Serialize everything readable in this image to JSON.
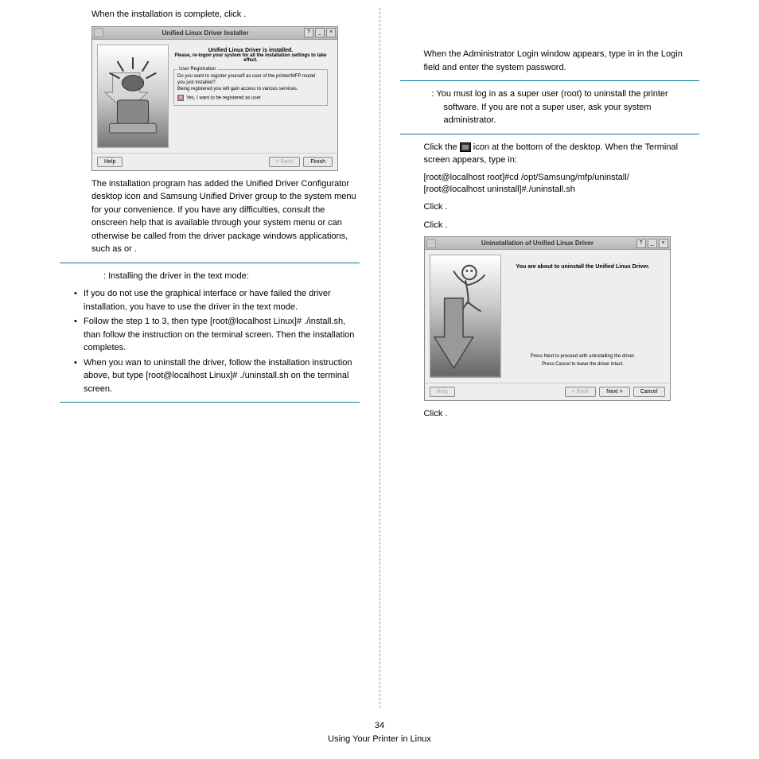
{
  "left": {
    "line1_a": "When the installation is complete, click ",
    "line1_b": ".",
    "dialog1": {
      "title": "Unified Linux Driver Installer",
      "btns": [
        "?",
        "_",
        "×"
      ],
      "heading": "Unified Linux Driver is installed.",
      "sub": "Please, re-logon your system for all the installation settings to take effect.",
      "fs_title": "User Registration",
      "fs_line1": "Do you want to register yourself as user of the printer/MFP model you just installed?",
      "fs_line2": "Being registered you will gain access to various services.",
      "fs_check": "Yes, I want to be registered as user",
      "help": "Help",
      "back": "< Back",
      "finish": "Finish"
    },
    "para2": "The installation program has added the Unified Driver Configurator desktop icon and Samsung Unified Driver group to the system menu for your convenience. If you have any difficulties, consult the onscreen help that is available through your system menu or can otherwise be called from the driver package windows applications, such as ",
    "para2_mid": " or ",
    "para2_end": ".",
    "note_label": ": Installing the driver in the text mode:",
    "bullets": [
      "If you do not use the graphical interface or have failed the driver installation, you have to use the driver in the text mode.",
      "Follow the step 1 to 3, then type [root@localhost Linux]# ./install.sh, than follow the instruction on the terminal screen. Then the installation completes.",
      "When you wan to uninstall the driver, follow the installation instruction above, but type [root@localhost Linux]# ./uninstall.sh on the terminal screen."
    ]
  },
  "right": {
    "step2a": "When the Administrator Login window appears, type in ",
    "step2b": " in the Login field and enter the system password.",
    "note": ": You must log in as a super user (root) to uninstall the printer software. If you are not a super user, ask your system administrator.",
    "step3a": "Click the ",
    "step3b": " icon at the bottom of the desktop. When the Terminal screen appears, type in:",
    "cmd1": "[root@localhost root]#cd /opt/Samsung/mfp/uninstall/",
    "cmd2": "[root@localhost uninstall]#./uninstall.sh",
    "step4": "Click ",
    "step4end": ".",
    "step5": "Click ",
    "step5end": ".",
    "dialog2": {
      "title": "Uninstallation of Unified Linux Driver",
      "btns": [
        "?",
        "_",
        "×"
      ],
      "heading": "You are about to uninstall the Unified Linux Driver.",
      "line1": "Press Next to proceed with uninstalling the driver.",
      "line2": "Press Cancel to leave the driver intact.",
      "help": "Help",
      "back": "< Back",
      "next": "Next >",
      "cancel": "Cancel"
    },
    "step6": "Click ",
    "step6end": "."
  },
  "footer": {
    "page": "34",
    "title": "Using Your Printer in Linux"
  }
}
